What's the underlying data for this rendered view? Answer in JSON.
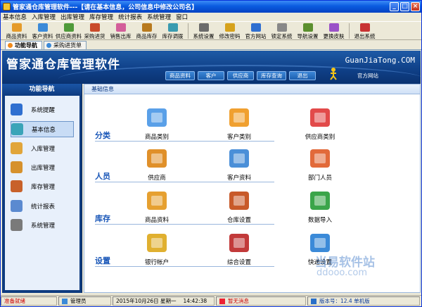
{
  "window": {
    "title": "管家通仓库管理软件---【请在基本信息，公司信息中修改公司名】"
  },
  "menubar": [
    "基本信息",
    "入库管理",
    "出库管理",
    "库存管理",
    "统计报表",
    "系统管理",
    "窗口"
  ],
  "toolbar": [
    {
      "label": "商品资料",
      "icon": "product-icon",
      "color": "#e59b2a"
    },
    {
      "label": "客户资料",
      "icon": "customer-icon",
      "color": "#3b8ad8"
    },
    {
      "label": "供应商资料",
      "icon": "supplier-icon",
      "color": "#4f9a3a"
    },
    {
      "label": "采购进货",
      "icon": "purchase-icon",
      "color": "#c94a2a"
    },
    {
      "label": "销售出库",
      "icon": "sales-icon",
      "color": "#d35e9a"
    },
    {
      "label": "商品库存",
      "icon": "stock-icon",
      "color": "#b87a1e"
    },
    {
      "label": "库存调拨",
      "icon": "transfer-icon",
      "color": "#3a9bb0"
    },
    {
      "label": "系统设置",
      "icon": "settings-icon",
      "color": "#6b6b6b"
    },
    {
      "label": "修改密码",
      "icon": "password-icon",
      "color": "#d6a21c"
    },
    {
      "label": "官方网站",
      "icon": "website-icon",
      "color": "#2f6fd0"
    },
    {
      "label": "锁定系统",
      "icon": "lock-icon",
      "color": "#888888"
    },
    {
      "label": "导航设置",
      "icon": "nav-icon",
      "color": "#5b8f2e"
    },
    {
      "label": "更换皮肤",
      "icon": "skin-icon",
      "color": "#9a52c8"
    },
    {
      "label": "退出系统",
      "icon": "exit-icon",
      "color": "#c83232"
    }
  ],
  "tabs": [
    {
      "label": "功能导航",
      "active": true
    },
    {
      "label": "采购进货单",
      "active": false
    }
  ],
  "banner": {
    "logo": "管家通仓库管理软件",
    "site": "GuanJiaTong.COM",
    "nav": [
      "商品资料",
      "客户",
      "供应商",
      "库存查询",
      "退出"
    ],
    "official": "官方网站"
  },
  "sidebar": {
    "title": "功能导航",
    "items": [
      {
        "label": "系统提醒",
        "color": "#2f6fd0"
      },
      {
        "label": "基本信息",
        "color": "#3aa4b8",
        "active": true
      },
      {
        "label": "入库管理",
        "color": "#e1a53a"
      },
      {
        "label": "出库管理",
        "color": "#d6912c"
      },
      {
        "label": "库存管理",
        "color": "#c8612a"
      },
      {
        "label": "统计报表",
        "color": "#5b8ad0"
      },
      {
        "label": "系统管理",
        "color": "#7a7a7a"
      }
    ]
  },
  "main": {
    "header": "基础信息",
    "sections": [
      {
        "title": "分类",
        "items": [
          "商品类别",
          "客户类别",
          "供应商类别"
        ]
      },
      {
        "title": "人员",
        "items": [
          "供应商",
          "客户资料",
          "部门人员"
        ]
      },
      {
        "title": "库存",
        "items": [
          "商品资料",
          "仓库设置",
          "数据导入"
        ]
      },
      {
        "title": "设置",
        "items": [
          "银行帐户",
          "综合设置",
          "快递设置"
        ]
      }
    ],
    "watermark": "当易软件站",
    "watermark_url": "ddooo.com"
  },
  "statusbar": {
    "ready": "准备就绪",
    "user": "管理员",
    "datetime": "2015年10月26日 星期一　 14:42:38",
    "message": "暂无消息",
    "version": "版本号：12.4 单机版"
  }
}
